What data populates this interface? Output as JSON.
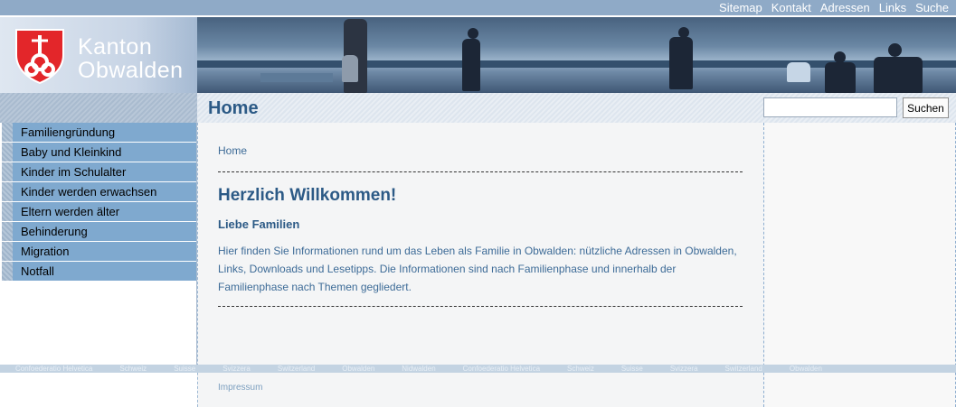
{
  "topbar": {
    "links": [
      "Sitemap",
      "Kontakt",
      "Adressen",
      "Links",
      "Suche"
    ]
  },
  "brand": {
    "line1": "Kanton",
    "line2": "Obwalden"
  },
  "header": {
    "title": "Home",
    "search_placeholder": "",
    "search_button": "Suchen"
  },
  "nav": {
    "items": [
      "Familiengründung",
      "Baby und Kleinkind",
      "Kinder im Schulalter",
      "Kinder werden erwachsen",
      "Eltern werden älter",
      "Behinderung",
      "Migration",
      "Notfall"
    ]
  },
  "main": {
    "breadcrumb": "Home",
    "heading": "Herzlich Willkommen!",
    "subheading": "Liebe Familien",
    "intro": "Hier finden Sie Informationen rund um das Leben als Familie in Obwalden: nützliche Adressen in Obwalden, Links, Downloads und Lesetipps. Die Informationen sind nach Familienphase und innerhalb der Familienphase nach Themen gegliedert."
  },
  "footer": {
    "band_words": [
      "Confoederatio Helvetica",
      "Schweiz",
      "Suisse",
      "Svizzera",
      "Switzerland",
      "Obwalden",
      "Nidwalden",
      "Confoederatio Helvetica",
      "Schweiz",
      "Suisse",
      "Svizzera",
      "Switzerland",
      "Obwalden"
    ],
    "impressum": "Impressum"
  },
  "colors": {
    "accent": "#2c5a86",
    "nav_bg": "#7fa9cf",
    "topbar_bg": "#8faac7"
  }
}
